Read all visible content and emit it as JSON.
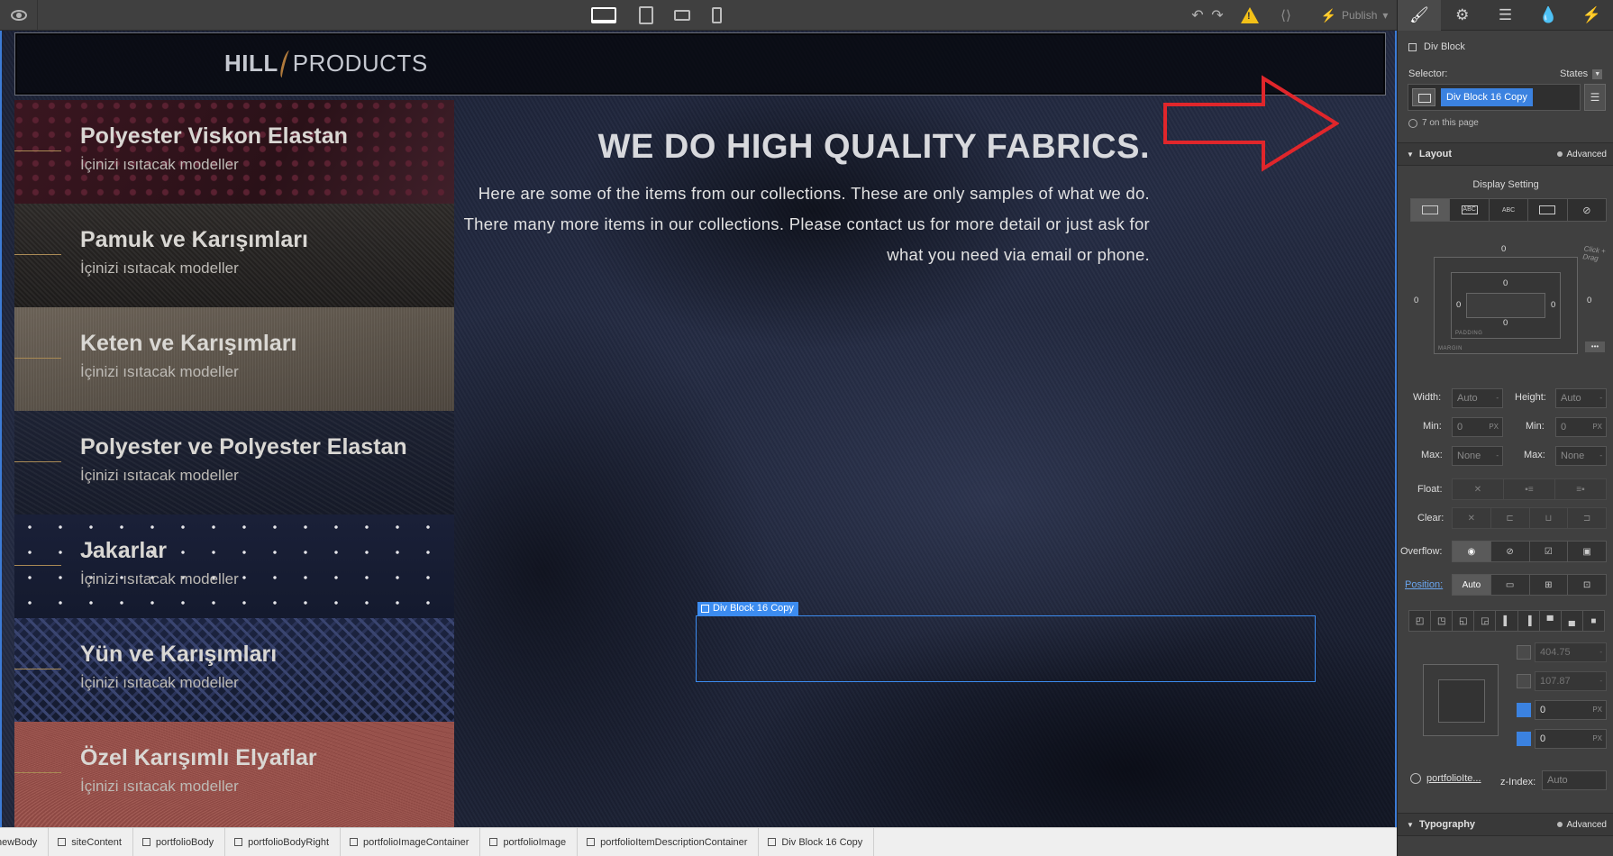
{
  "toolbar": {
    "undo": "↶",
    "redo": "↷",
    "code": "⟨⟩",
    "publish_label": "Publish",
    "warning_glyph": "!",
    "devices": [
      "desktop",
      "tablet",
      "landscape-phone",
      "phone"
    ]
  },
  "site": {
    "logo_left": "HILL",
    "logo_right": "PRODUCTS",
    "hero_title": "WE DO HIGH QUALITY FABRICS.",
    "hero_text": "Here are some of the items from our collections. These are only samples of what we do. There many more items in our collections. Please contact us for more detail or just ask for what you need via email or phone.",
    "categories": [
      {
        "title": "Polyester Viskon Elastan",
        "subtitle": "İçinizi ısıtacak modeller"
      },
      {
        "title": "Pamuk ve Karışımları",
        "subtitle": "İçinizi ısıtacak modeller"
      },
      {
        "title": "Keten ve Karışımları",
        "subtitle": "İçinizi ısıtacak modeller"
      },
      {
        "title": "Polyester ve Polyester Elastan",
        "subtitle": "İçinizi ısıtacak modeller"
      },
      {
        "title": "Jakarlar",
        "subtitle": "İçinizi ısıtacak modeller"
      },
      {
        "title": "Yün ve Karışımları",
        "subtitle": "İçinizi ısıtacak modeller"
      },
      {
        "title": "Özel Karışımlı Elyaflar",
        "subtitle": "İçinizi ısıtacak modeller"
      }
    ],
    "selected_label": "Div Block 16 Copy"
  },
  "breadcrumb": [
    "newBody",
    "siteContent",
    "portfolioBody",
    "portfolioBodyRight",
    "portfolioImageContainer",
    "portfolioImage",
    "portfolioItemDescriptionContainer",
    "Div Block 16 Copy"
  ],
  "panel": {
    "element_type": "Div Block",
    "selector_label": "Selector:",
    "states_label": "States",
    "selector_chip": "Div Block 16 Copy",
    "on_page": "7 on this page",
    "layout_label": "Layout",
    "advanced_label": "Advanced",
    "display_label": "Display Setting",
    "display_options": [
      "",
      "ABC",
      "ABC",
      "",
      ""
    ],
    "box": {
      "margin_top": "0",
      "margin_bottom": "0",
      "margin_left": "0",
      "margin_right": "0",
      "padding_top": "0",
      "padding_bottom": "0",
      "padding_left": "0",
      "padding_right": "0",
      "margin_tag": "MARGIN",
      "padding_tag": "PADDING",
      "hint": "Click + Drag",
      "more": "•••"
    },
    "width_label": "Width:",
    "width_value": "Auto",
    "height_label": "Height:",
    "height_value": "Auto",
    "min_label": "Min:",
    "min_w": "0",
    "min_h": "0",
    "unit": "PX",
    "max_label": "Max:",
    "max_w": "None",
    "max_h": "None",
    "float_label": "Float:",
    "clear_label": "Clear:",
    "overflow_label": "Overflow:",
    "position_label": "Position:",
    "position_auto": "Auto",
    "pos_top": "404.75",
    "pos_left": "107.87",
    "pos_right": "0",
    "pos_bottom": "0",
    "relative_to": "portfolioIte...",
    "zindex_label": "z-Index:",
    "zindex_value": "Auto",
    "typography_label": "Typography",
    "dropdown_glyph": "▾",
    "caret_glyph": "▼",
    "x_glyph": "✕",
    "menu_glyph": "☰"
  },
  "colors": {
    "accent": "#3c8cf0",
    "warning": "#f2c018",
    "annotation": "#e0262b"
  }
}
